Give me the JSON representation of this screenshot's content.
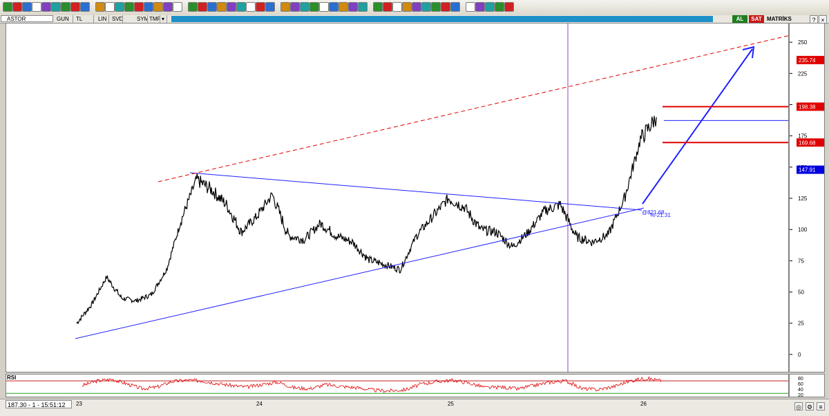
{
  "toolbar": {
    "symbol": "ASTOR",
    "period": "GUN",
    "currency": "TL",
    "scale": "LIN",
    "buttons": [
      "SVD",
      "SYM",
      "TMP"
    ],
    "icon_label": "VSBN"
  },
  "header_right": {
    "buy_label": "AL",
    "sell_label": "SAT",
    "brand": "MATRİKS"
  },
  "status": {
    "text": "187.30 - 1 - 15:51:12"
  },
  "rsi": {
    "title": "RSI",
    "labels": [
      "80",
      "60",
      "40",
      "20"
    ]
  },
  "annotations": {
    "label1": "@821.68",
    "label2": "%-21.31"
  },
  "colors": {
    "trendline": "#2020ff",
    "red": "#e00000",
    "vertical_marker": "#9040c0",
    "price_line": "#000000"
  },
  "chart_data": {
    "type": "line",
    "series": [
      {
        "x": [
          "2023-01",
          "2023-02",
          "2023-03",
          "2023-04",
          "2023-05",
          "2023-06",
          "2023-07",
          "2023-08",
          "2023-09",
          "2023-10",
          "2023-11",
          "2023-12",
          "2024-01",
          "2024-02",
          "2024-03",
          "2024-04",
          "2024-05",
          "2024-06",
          "2024-07",
          "2024-08",
          "2024-09",
          "2024-10",
          "2024-11",
          "2024-12",
          "2025-01",
          "2025-02",
          "2025-03",
          "2025-04",
          "2025-05",
          "2025-06",
          "2025-07",
          "2025-08",
          "2025-09",
          "2025-10",
          "2025-11",
          "2025-12",
          "2026-01",
          "2026-02"
        ],
        "values": [
          25,
          40,
          62,
          45,
          43,
          48,
          68,
          108,
          140,
          132,
          120,
          98,
          110,
          128,
          95,
          92,
          105,
          95,
          90,
          76,
          72,
          68,
          95,
          110,
          125,
          118,
          100,
          98,
          86,
          98,
          115,
          120,
          94,
          90,
          96,
          125,
          172,
          190
        ]
      }
    ],
    "ylim": [
      -15,
      265
    ],
    "yticks": [
      0,
      25,
      50,
      75,
      100,
      125,
      150,
      175,
      200,
      225,
      250
    ],
    "xtick_labels": [
      "23",
      "24",
      "25",
      "26"
    ],
    "price_tags": [
      {
        "value": 235.74,
        "label": "235.74",
        "color": "#e00000"
      },
      {
        "value": 198.38,
        "label": "198.38",
        "color": "#e00000"
      },
      {
        "value": 169.68,
        "label": "169.68",
        "color": "#e00000"
      },
      {
        "value": 147.91,
        "label": "147.91",
        "color": "#0000e0"
      }
    ],
    "rsi_values": [
      55,
      70,
      75,
      60,
      45,
      50,
      68,
      72,
      70,
      62,
      55,
      50,
      58,
      66,
      48,
      45,
      58,
      52,
      48,
      40,
      38,
      42,
      60,
      68,
      72,
      62,
      48,
      50,
      44,
      55,
      65,
      70,
      45,
      42,
      52,
      70,
      78,
      70
    ],
    "rsi_ylim": [
      15,
      90
    ],
    "rsi_levels": [
      70,
      30
    ]
  }
}
